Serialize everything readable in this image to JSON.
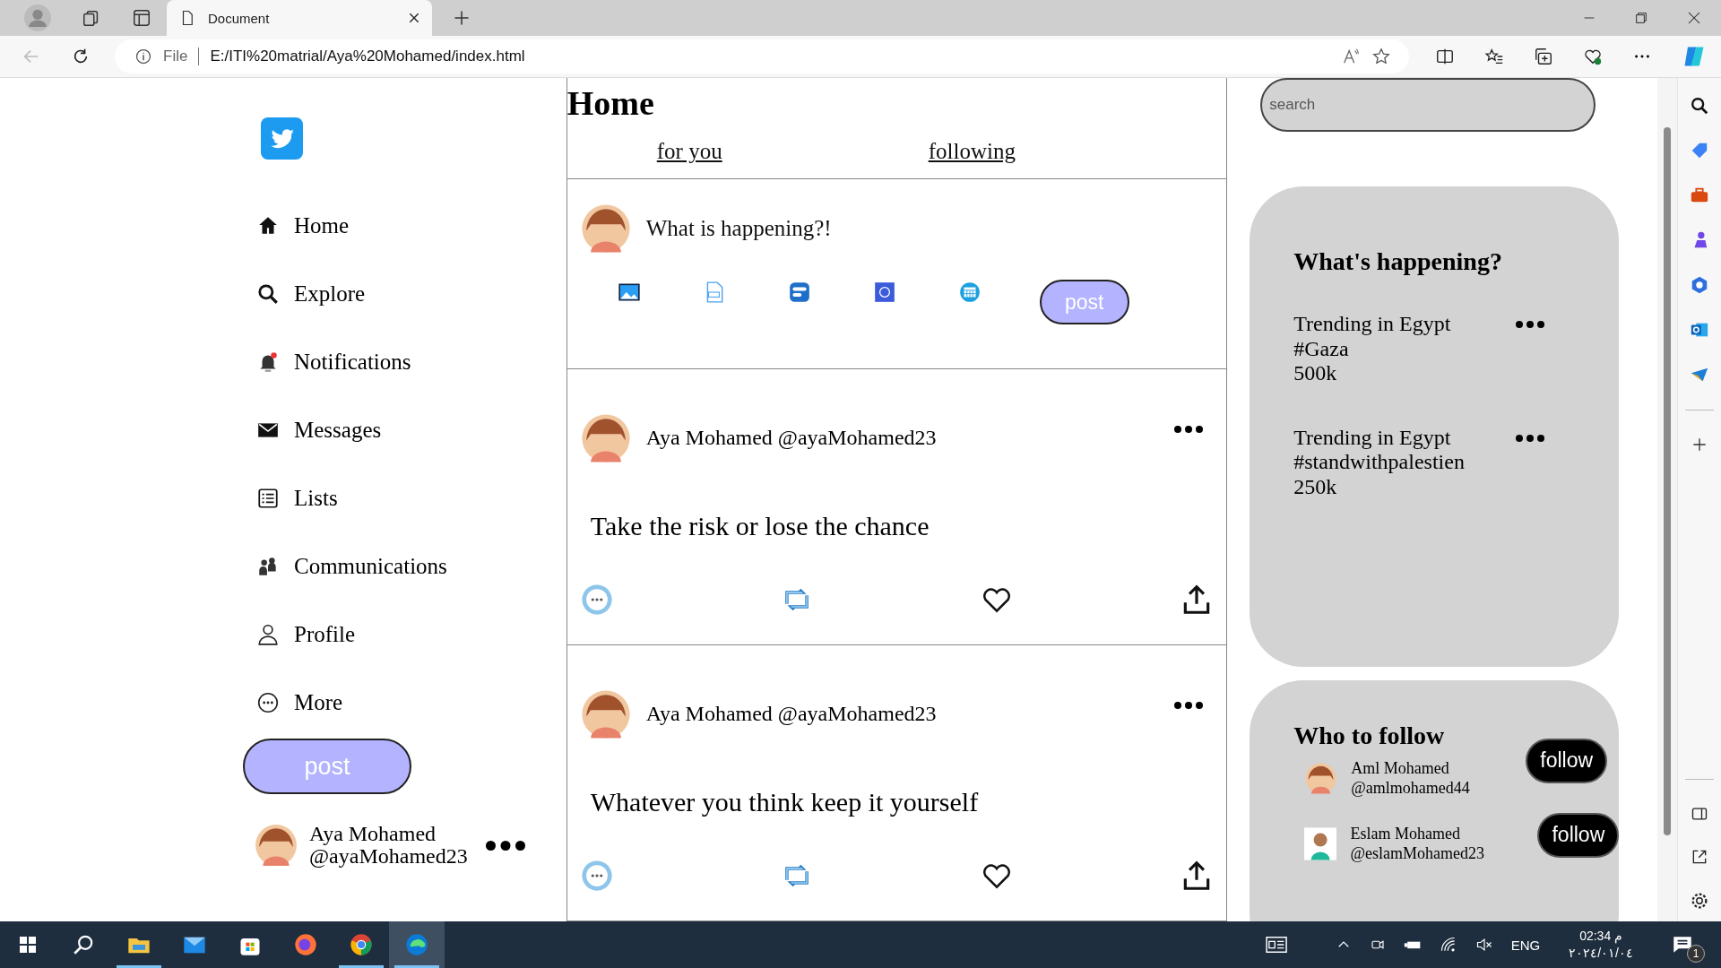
{
  "browser": {
    "tabs": [
      {
        "title": "Document",
        "selected": true
      }
    ],
    "address": {
      "scheme": "File",
      "url": "E:/ITI%20matrial/Aya%20Mohamed/index.html"
    }
  },
  "nav": {
    "items": [
      {
        "label": "Home"
      },
      {
        "label": "Explore"
      },
      {
        "label": "Notifications"
      },
      {
        "label": "Messages"
      },
      {
        "label": "Lists"
      },
      {
        "label": "Communications"
      },
      {
        "label": "Profile"
      },
      {
        "label": "More"
      }
    ],
    "post_button": "post",
    "account": {
      "name": "Aya Mohamed",
      "handle": "@ayaMohamed23"
    }
  },
  "main": {
    "title": "Home",
    "tabs": [
      {
        "label": "for you",
        "selected": false
      },
      {
        "label": "following",
        "selected": false
      }
    ],
    "composer": {
      "placeholder": "What is happening?!",
      "post_button": "post"
    },
    "posts": [
      {
        "author": "Aya Mohamed @ayaMohamed23",
        "text": "Take the risk or lose the chance"
      },
      {
        "author": "Aya Mohamed @ayaMohamed23",
        "text": "Whatever you think keep it yourself"
      }
    ]
  },
  "search": {
    "placeholder": "search"
  },
  "trends": {
    "title": "What's happening?",
    "items": [
      {
        "label": "Trending in Egypt",
        "tag": "#Gaza",
        "count": "500k"
      },
      {
        "label": "Trending in Egypt",
        "tag": "#standwithpalestien",
        "count": "250k"
      }
    ]
  },
  "who_to_follow": {
    "title": "Who to follow",
    "users": [
      {
        "name": "Aml Mohamed",
        "handle": "@amlmohamed44",
        "button": "follow"
      },
      {
        "name": "Eslam Mohamed",
        "handle": "@eslamMohamed23",
        "button": "follow"
      }
    ]
  },
  "taskbar": {
    "apps": [
      {
        "running": false,
        "selected": false
      },
      {
        "running": false,
        "selected": false
      },
      {
        "running": true,
        "selected": false
      },
      {
        "running": false,
        "selected": false
      },
      {
        "running": false,
        "selected": false
      },
      {
        "running": false,
        "selected": false
      },
      {
        "running": true,
        "selected": false
      },
      {
        "running": true,
        "selected": true
      }
    ],
    "language": "ENG",
    "time": "02:34 م",
    "date": "٢٠٢٤/٠١/٠٤",
    "notifications": "1"
  }
}
